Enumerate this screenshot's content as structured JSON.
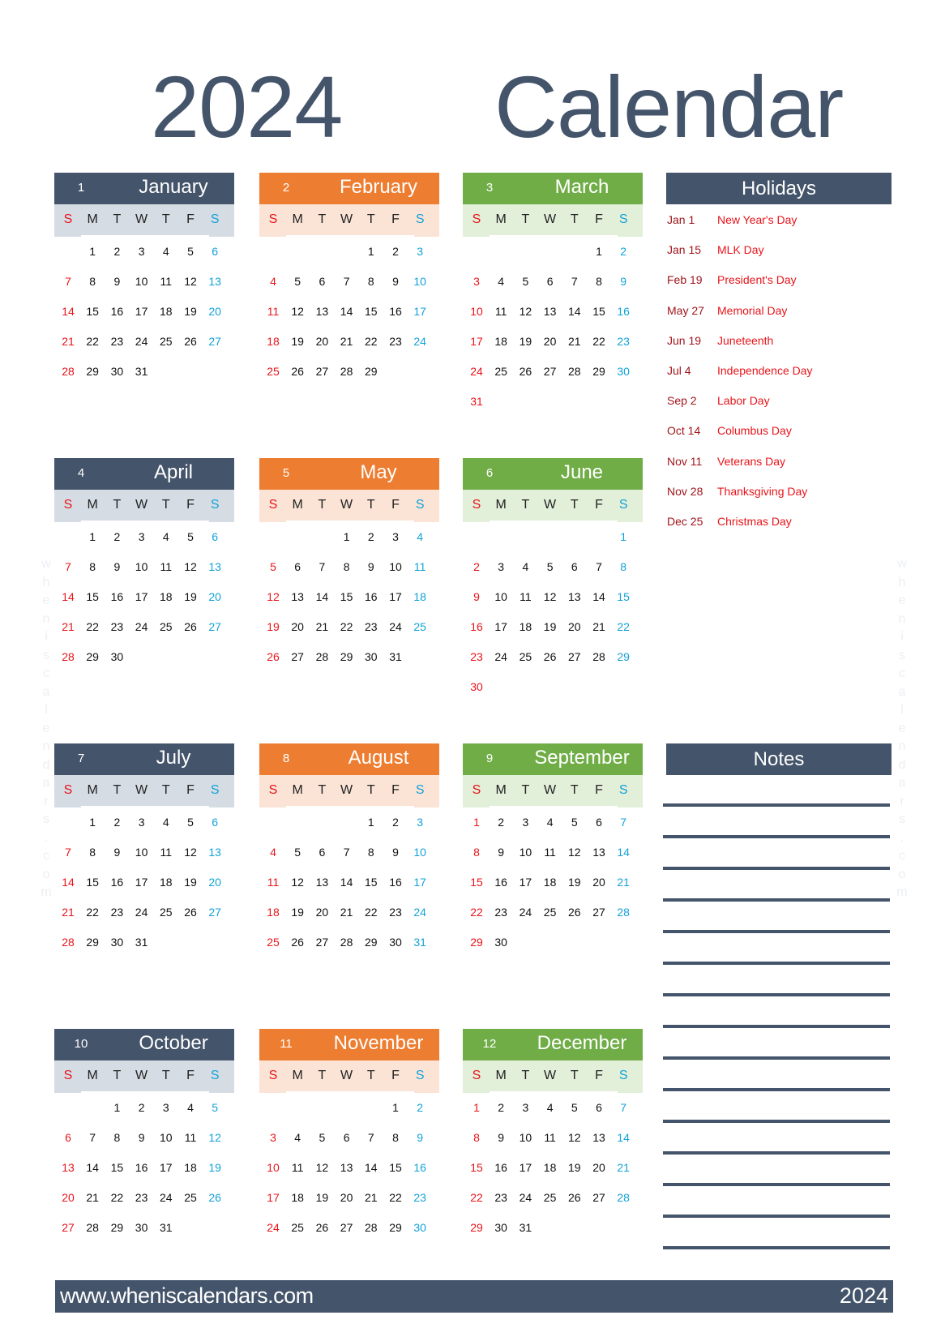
{
  "title": {
    "year": "2024",
    "word": "Calendar"
  },
  "weekdays": [
    "S",
    "M",
    "T",
    "W",
    "T",
    "F",
    "S"
  ],
  "months": [
    {
      "num": "1",
      "name": "January",
      "theme": "blue",
      "start": 1,
      "days": 31
    },
    {
      "num": "2",
      "name": "February",
      "theme": "orange",
      "start": 4,
      "days": 29
    },
    {
      "num": "3",
      "name": "March",
      "theme": "green",
      "start": 5,
      "days": 31
    },
    {
      "num": "4",
      "name": "April",
      "theme": "blue",
      "start": 1,
      "days": 30
    },
    {
      "num": "5",
      "name": "May",
      "theme": "orange",
      "start": 3,
      "days": 31
    },
    {
      "num": "6",
      "name": "June",
      "theme": "green",
      "start": 6,
      "days": 30
    },
    {
      "num": "7",
      "name": "July",
      "theme": "blue",
      "start": 1,
      "days": 31
    },
    {
      "num": "8",
      "name": "August",
      "theme": "orange",
      "start": 4,
      "days": 31
    },
    {
      "num": "9",
      "name": "September",
      "theme": "green",
      "start": 0,
      "days": 30
    },
    {
      "num": "10",
      "name": "October",
      "theme": "blue",
      "start": 2,
      "days": 31
    },
    {
      "num": "11",
      "name": "November",
      "theme": "orange",
      "start": 5,
      "days": 30
    },
    {
      "num": "12",
      "name": "December",
      "theme": "green",
      "start": 0,
      "days": 31
    }
  ],
  "holidays": {
    "title": "Holidays",
    "items": [
      {
        "date": "Jan 1",
        "name": "New Year's Day"
      },
      {
        "date": "Jan 15",
        "name": "MLK Day"
      },
      {
        "date": "Feb 19",
        "name": "President's Day"
      },
      {
        "date": "May 27",
        "name": "Memorial Day"
      },
      {
        "date": "Jun 19",
        "name": "Juneteenth"
      },
      {
        "date": "Jul 4",
        "name": "Independence Day"
      },
      {
        "date": "Sep 2",
        "name": "Labor Day"
      },
      {
        "date": "Oct 14",
        "name": "Columbus Day"
      },
      {
        "date": "Nov 11",
        "name": "Veterans Day"
      },
      {
        "date": "Nov 28",
        "name": "Thanksgiving Day"
      },
      {
        "date": "Dec 25",
        "name": "Christmas Day"
      }
    ]
  },
  "notes": {
    "title": "Notes",
    "line_count": 15
  },
  "footer": {
    "url": "www.wheniscalendars.com",
    "year": "2024"
  },
  "watermark": "wheniscalendars.com",
  "colors": {
    "navy": "#44546a",
    "orange": "#ed7d31",
    "green": "#70ad47",
    "sunday": "#e8141a",
    "saturday": "#12a2d8",
    "holiday_date": "#a0151b",
    "holiday_name": "#e8141a"
  }
}
